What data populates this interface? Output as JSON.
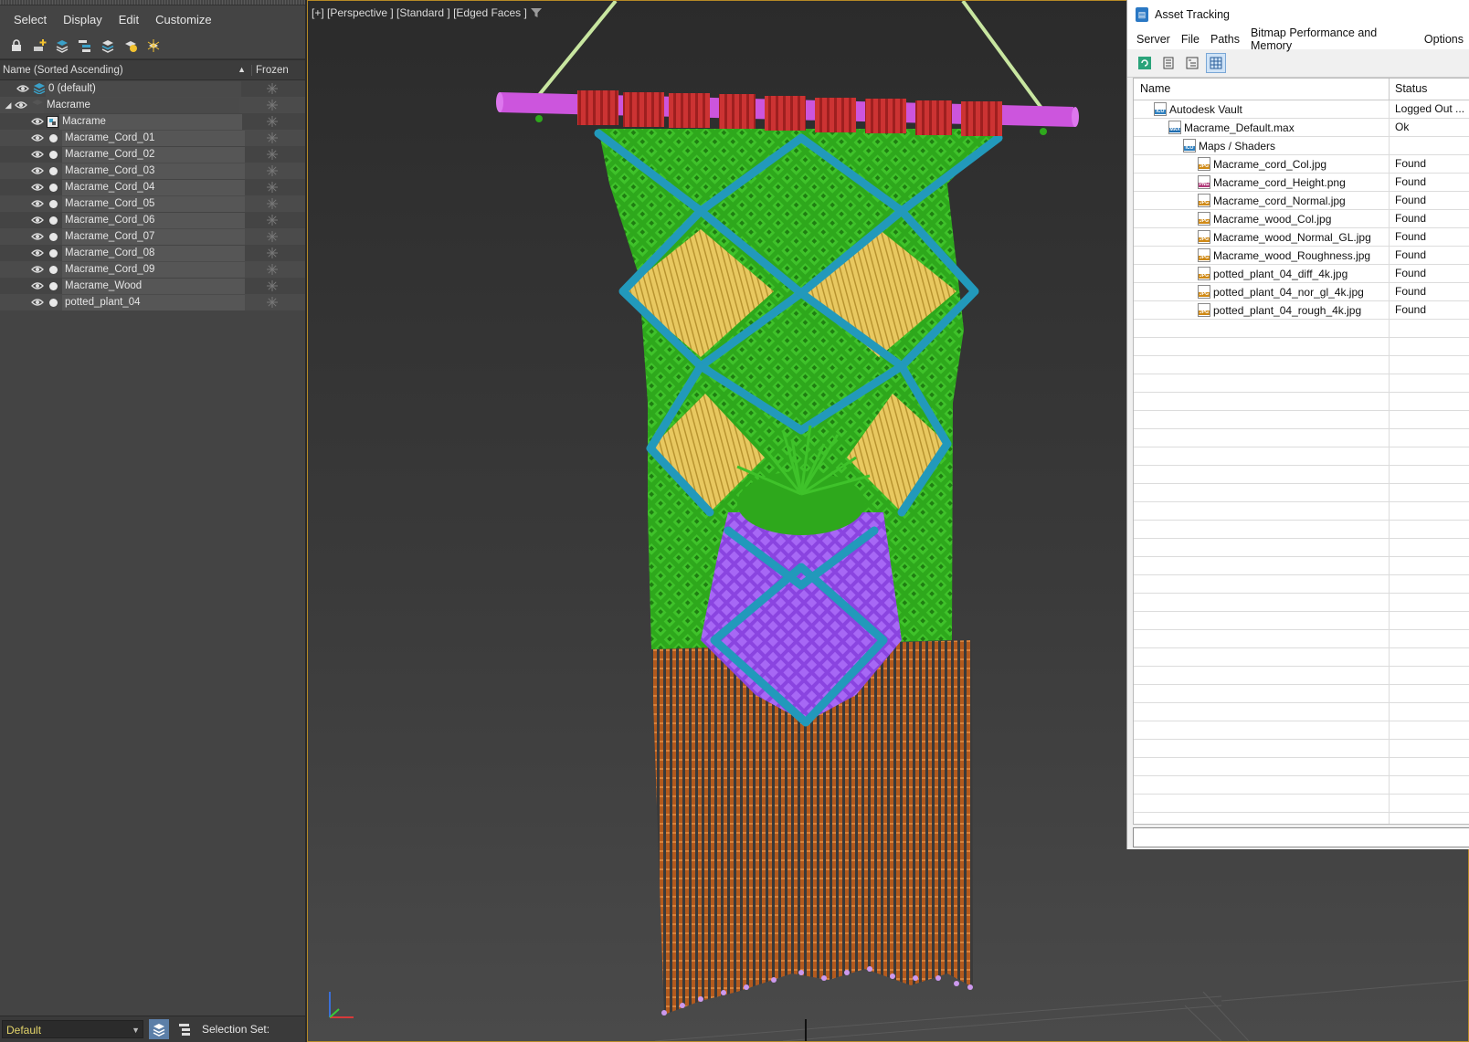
{
  "explorer": {
    "menu": [
      "Select",
      "Display",
      "Edit",
      "Customize"
    ],
    "columns": {
      "name": "Name (Sorted Ascending)",
      "frozen": "Frozen"
    },
    "rows": [
      {
        "label": "0 (default)",
        "level": 0,
        "kind": "layer"
      },
      {
        "label": "Macrame",
        "level": 0,
        "kind": "group"
      },
      {
        "label": "Macrame",
        "level": 1,
        "kind": "group-object"
      },
      {
        "label": "Macrame_Cord_01",
        "level": 1,
        "kind": "object"
      },
      {
        "label": "Macrame_Cord_02",
        "level": 1,
        "kind": "object"
      },
      {
        "label": "Macrame_Cord_03",
        "level": 1,
        "kind": "object"
      },
      {
        "label": "Macrame_Cord_04",
        "level": 1,
        "kind": "object"
      },
      {
        "label": "Macrame_Cord_05",
        "level": 1,
        "kind": "object"
      },
      {
        "label": "Macrame_Cord_06",
        "level": 1,
        "kind": "object"
      },
      {
        "label": "Macrame_Cord_07",
        "level": 1,
        "kind": "object"
      },
      {
        "label": "Macrame_Cord_08",
        "level": 1,
        "kind": "object"
      },
      {
        "label": "Macrame_Cord_09",
        "level": 1,
        "kind": "object"
      },
      {
        "label": "Macrame_Wood",
        "level": 1,
        "kind": "object"
      },
      {
        "label": "potted_plant_04",
        "level": 1,
        "kind": "object"
      }
    ],
    "bottom": {
      "layer": "Default",
      "selection_set": "Selection Set:"
    }
  },
  "viewport": {
    "label": "[+] [Perspective ] [Standard ] [Edged Faces ]"
  },
  "asset_tracking": {
    "title": "Asset Tracking",
    "menu": [
      "Server",
      "File",
      "Paths",
      "Bitmap Performance and Memory",
      "Options"
    ],
    "columns": {
      "name": "Name",
      "status": "Status"
    },
    "rows": [
      {
        "name": "Autodesk Vault",
        "status": "Logged Out ...",
        "level": 1,
        "icon": "ico"
      },
      {
        "name": "Macrame_Default.max",
        "status": "Ok",
        "level": 2,
        "icon": "max"
      },
      {
        "name": "Maps / Shaders",
        "status": "",
        "level": 3,
        "icon": "ico"
      },
      {
        "name": "Macrame_cord_Col.jpg",
        "status": "Found",
        "level": 4,
        "icon": "jpg"
      },
      {
        "name": "Macrame_cord_Height.png",
        "status": "Found",
        "level": 4,
        "icon": "png"
      },
      {
        "name": "Macrame_cord_Normal.jpg",
        "status": "Found",
        "level": 4,
        "icon": "jpg"
      },
      {
        "name": "Macrame_wood_Col.jpg",
        "status": "Found",
        "level": 4,
        "icon": "jpg"
      },
      {
        "name": "Macrame_wood_Normal_GL.jpg",
        "status": "Found",
        "level": 4,
        "icon": "jpg"
      },
      {
        "name": "Macrame_wood_Roughness.jpg",
        "status": "Found",
        "level": 4,
        "icon": "jpg"
      },
      {
        "name": "potted_plant_04_diff_4k.jpg",
        "status": "Found",
        "level": 4,
        "icon": "jpg"
      },
      {
        "name": "potted_plant_04_nor_gl_4k.jpg",
        "status": "Found",
        "level": 4,
        "icon": "jpg"
      },
      {
        "name": "potted_plant_04_rough_4k.jpg",
        "status": "Found",
        "level": 4,
        "icon": "jpg"
      }
    ]
  },
  "colors": {
    "viewport_border": "#b68a26",
    "rod": "#cc55dd",
    "top_knots": "#cc3333",
    "green_knots": "#33bb22",
    "teal_cords": "#2299bb",
    "yellow_panels": "#e8c860",
    "purple_pocket": "#9955ee",
    "fringe": "#b25a1e",
    "fringe_tips": "#cc99ee",
    "hanging_cord": "#c8e6a0"
  }
}
